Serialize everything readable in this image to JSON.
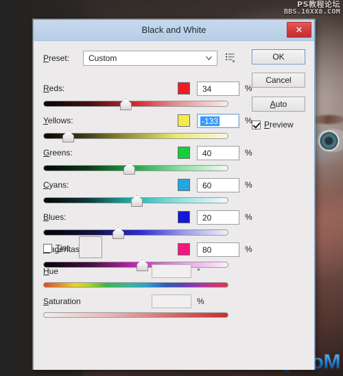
{
  "window": {
    "title": "Black and White",
    "close_label": "✕"
  },
  "preset": {
    "label": "Preset:",
    "label_accel": "P",
    "value": "Custom",
    "chevron_icon": "chevron-down-icon",
    "options_icon": "preset-options-icon"
  },
  "buttons": {
    "ok": "OK",
    "cancel": "Cancel",
    "auto": "Auto"
  },
  "preview": {
    "label": "Preview",
    "checked": true
  },
  "channels": [
    {
      "label": "Reds:",
      "value": "34",
      "unit": "%",
      "swatch": "#ee1c25",
      "focused": false,
      "thumb_pct": 44,
      "track_gradient": "linear-gradient(90deg,#050505 0%,#4a1014 26%,#cf2b34 50%,#e88e92 72%,#f7eded 100%)"
    },
    {
      "label": "Yellows:",
      "value": "-133",
      "unit": "%",
      "swatch": "#f6ea4a",
      "focused": true,
      "thumb_pct": 13,
      "track_gradient": "linear-gradient(90deg,#070707 0%,#3c3a17 22%,#9d9a3a 48%,#eae96e 72%,#f8f7e4 100%)"
    },
    {
      "label": "Greens:",
      "value": "40",
      "unit": "%",
      "swatch": "#14cf3c",
      "focused": false,
      "thumb_pct": 46,
      "track_gradient": "linear-gradient(90deg,#050505 0%,#0c3a19 24%,#25a84a 50%,#8ddca2 74%,#f1faf2 100%)"
    },
    {
      "label": "Cyans:",
      "value": "60",
      "unit": "%",
      "swatch": "#22a7e0",
      "focused": false,
      "thumb_pct": 50,
      "track_gradient": "linear-gradient(90deg,#050505 0%,#0d3a3c 24%,#25bab3 50%,#95e0e1 74%,#f0fafa 100%)"
    },
    {
      "label": "Blues:",
      "value": "20",
      "unit": "%",
      "swatch": "#1616d8",
      "focused": false,
      "thumb_pct": 40,
      "track_gradient": "linear-gradient(90deg,#050505 0%,#121246 28%,#2b2bd2 52%,#9a9aea 76%,#f0f0fb 100%)"
    },
    {
      "label": "Magentas:",
      "value": "80",
      "unit": "%",
      "swatch": "#f0187c",
      "focused": false,
      "thumb_pct": 53,
      "track_gradient": "linear-gradient(90deg,#050505 0%,#451240 26%,#cc2ac0 52%,#e9a0e3 76%,#fbf0fa 100%)"
    }
  ],
  "tint": {
    "label": "Tint",
    "checked": false,
    "swatch_color": "#eceaea"
  },
  "hue": {
    "label": "Hue",
    "value": "",
    "unit": "°"
  },
  "saturation": {
    "label": "Saturation",
    "value": "",
    "unit": "%"
  },
  "watermarks": {
    "top_line1": "PS教程论坛",
    "top_line2": "BBS.16XX8.COM",
    "bottom": "UiBQ.CoM"
  }
}
